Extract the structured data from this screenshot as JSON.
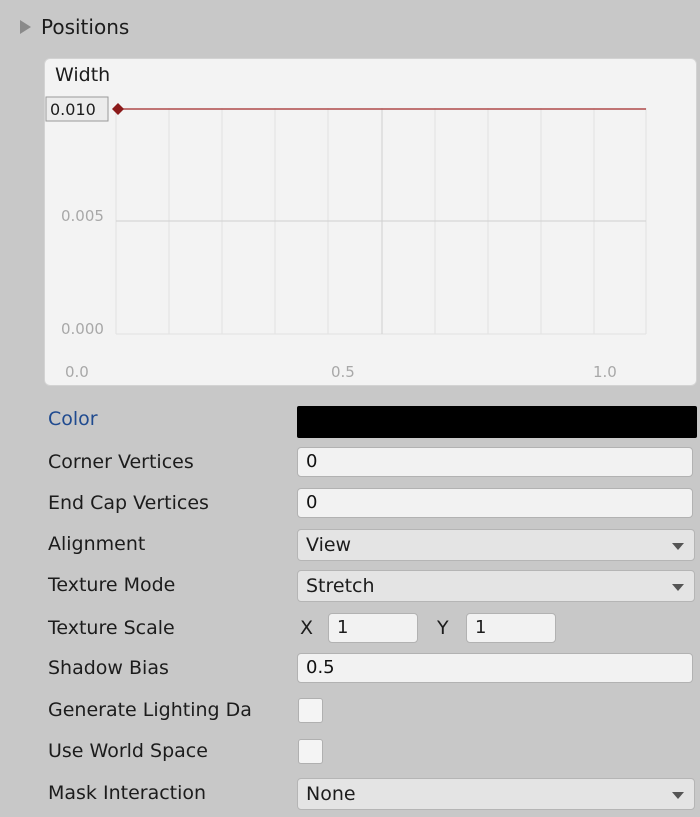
{
  "positions": {
    "label": "Positions"
  },
  "width_curve": {
    "title": "Width",
    "key_value_label": "0.010",
    "y_tick_labels": [
      "0.010",
      "0.005",
      "0.000"
    ],
    "x_tick_labels": [
      "0.0",
      "0.5",
      "1.0"
    ],
    "curve_color": "#b04a4a",
    "key_color": "#8b1a1a",
    "curve_value": 0.01
  },
  "color": {
    "label": "Color",
    "value": "#000000"
  },
  "corner_vertices": {
    "label": "Corner Vertices",
    "value": "0"
  },
  "end_cap_vertices": {
    "label": "End Cap Vertices",
    "value": "0"
  },
  "alignment": {
    "label": "Alignment",
    "value": "View"
  },
  "texture_mode": {
    "label": "Texture Mode",
    "value": "Stretch"
  },
  "texture_scale": {
    "label": "Texture Scale",
    "x_label": "X",
    "x_value": "1",
    "y_label": "Y",
    "y_value": "1"
  },
  "shadow_bias": {
    "label": "Shadow Bias",
    "value": "0.5"
  },
  "generate_lighting_data": {
    "label": "Generate Lighting Da",
    "checked": false
  },
  "use_world_space": {
    "label": "Use World Space",
    "checked": false
  },
  "mask_interaction": {
    "label": "Mask Interaction",
    "value": "None"
  }
}
